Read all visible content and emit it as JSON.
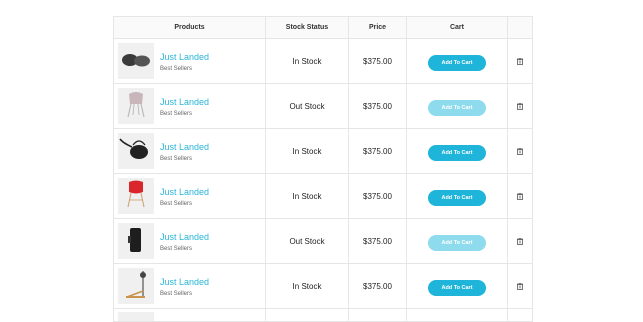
{
  "headers": {
    "products": "Products",
    "stock": "Stock Status",
    "price": "Price",
    "cart": "Cart"
  },
  "rows": [
    {
      "name": "Just Landed",
      "category": "Best Sellers",
      "stock": "In Stock",
      "price": "$375.00",
      "cart_label": "Add To Cart",
      "cart_enabled": true,
      "thumb_icon": "stones-icon"
    },
    {
      "name": "Just Landed",
      "category": "Best Sellers",
      "stock": "Out Stock",
      "price": "$375.00",
      "cart_label": "Add To Cart",
      "cart_enabled": false,
      "thumb_icon": "pink-chair-icon"
    },
    {
      "name": "Just Landed",
      "category": "Best Sellers",
      "stock": "In Stock",
      "price": "$375.00",
      "cart_label": "Add To Cart",
      "cart_enabled": true,
      "thumb_icon": "kettle-icon"
    },
    {
      "name": "Just Landed",
      "category": "Best Sellers",
      "stock": "In Stock",
      "price": "$375.00",
      "cart_label": "Add To Cart",
      "cart_enabled": true,
      "thumb_icon": "red-chair-icon"
    },
    {
      "name": "Just Landed",
      "category": "Best Sellers",
      "stock": "Out Stock",
      "price": "$375.00",
      "cart_label": "Add To Cart",
      "cart_enabled": false,
      "thumb_icon": "speaker-icon"
    },
    {
      "name": "Just Landed",
      "category": "Best Sellers",
      "stock": "In Stock",
      "price": "$375.00",
      "cart_label": "Add To Cart",
      "cart_enabled": true,
      "thumb_icon": "lamp-icon"
    }
  ],
  "colors": {
    "accent": "#1fb4d9",
    "accent_disabled": "#8fdbee",
    "product_link": "#29b6d8"
  }
}
